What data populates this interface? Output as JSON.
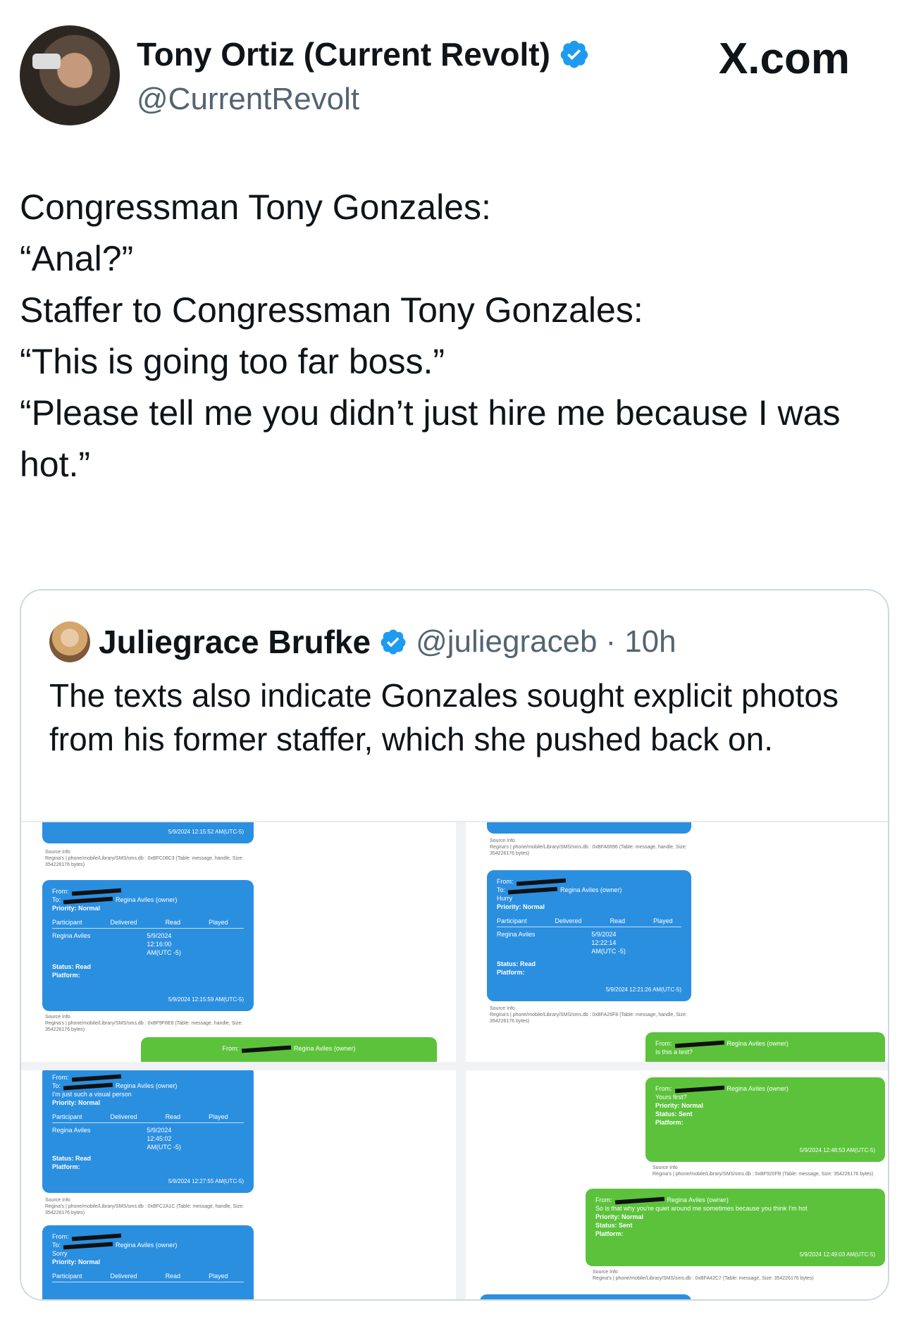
{
  "author": {
    "name": "Tony Ortiz (Current Revolt)",
    "handle": "@CurrentRevolt",
    "verified": true
  },
  "site": "X.com",
  "tweet": {
    "lines": [
      "Congressman Tony Gonzales:",
      "“Anal?”",
      "",
      "Staffer to Congressman Tony Gonzales:",
      "“This is going too far boss.”",
      "“Please tell me you didn’t just hire me because I was hot.”"
    ]
  },
  "quote": {
    "name": "Juliegrace Brufke",
    "handle": "@juliegraceb",
    "separator": "·",
    "time": "10h",
    "text": "The texts also indicate Gonzales sought explicit photos from his former staffer, which she pushed back on."
  },
  "media": {
    "panel1": {
      "bubble_top": {
        "ts": "5/9/2024 12:15:52 AM(UTC-5)"
      },
      "source1": "Source Info\nRegina's | phone/mobile/Library/SMS/sms.db : 0xBFC08C3 (Table: message, handle, Size: 354226176 bytes)",
      "bubble2": {
        "from": "From:",
        "to": "To:",
        "owner": "Regina Aviles (owner)",
        "priority": "Priority: Normal",
        "col_participant": "Participant",
        "col_delivered": "Delivered",
        "col_read": "Read",
        "col_played": "Played",
        "participant": "Regina Aviles",
        "read": "5/9/2024 12:16:00 AM(UTC -5)",
        "status": "Status: Read",
        "platform": "Platform:",
        "ts": "5/9/2024 12:15:59 AM(UTC-5)"
      },
      "source2": "Source Info\nRegina's | phone/mobile/Library/SMS/sms.db : 0xBF9F8E6 (Table: message, handle, Size: 354226176 bytes)",
      "green": {
        "from": "From:",
        "owner": "Regina Aviles (owner)"
      }
    },
    "panel2": {
      "source1": "Source Info\nRegina's | phone/mobile/Library/SMS/sms.db : 0xBFA6696 (Table: message, handle, Size: 354226176 bytes)",
      "bubble": {
        "from": "From:",
        "to": "To:",
        "owner": "Regina Aviles (owner)",
        "body": "Hurry",
        "priority": "Priority: Normal",
        "col_participant": "Participant",
        "col_delivered": "Delivered",
        "col_read": "Read",
        "col_played": "Played",
        "participant": "Regina Aviles",
        "read": "5/9/2024 12:22:14 AM(UTC -5)",
        "status": "Status: Read",
        "platform": "Platform:",
        "ts": "5/9/2024 12:21:26 AM(UTC-5)"
      },
      "source2": "Source Info\nRegina's | phone/mobile/Library/SMS/sms.db : 0xBFA26F8 (Table: message, handle, Size: 354226176 bytes)",
      "green": {
        "from": "From:",
        "owner": "Regina Aviles (owner)",
        "body": "Is this a test?"
      }
    },
    "panel3": {
      "bubble": {
        "from": "From:",
        "to": "To:",
        "owner": "Regina Aviles (owner)",
        "body": "I'm just such a visual person",
        "priority": "Priority: Normal",
        "col_participant": "Participant",
        "col_delivered": "Delivered",
        "col_read": "Read",
        "col_played": "Played",
        "participant": "Regina Aviles",
        "read": "5/9/2024 12:45:02 AM(UTC -5)",
        "status": "Status: Read",
        "platform": "Platform:",
        "ts": "5/9/2024 12:27:55 AM(UTC-5)"
      },
      "source": "Source Info\nRegina's | phone/mobile/Library/SMS/sms.db : 0xBFC2A1C (Table: message, handle, Size: 354226176 bytes)",
      "bubble2": {
        "from": "From:",
        "to": "To:",
        "owner": "Regina Aviles (owner)",
        "body": "Sorry",
        "priority": "Priority: Normal",
        "col_participant": "Participant",
        "col_delivered": "Delivered",
        "col_read": "Read",
        "col_played": "Played"
      }
    },
    "panel4": {
      "green1": {
        "from": "From:",
        "owner": "Regina Aviles (owner)",
        "body": "Yours first?",
        "priority": "Priority: Normal",
        "status": "Status: Sent",
        "platform": "Platform:",
        "ts": "5/9/2024 12:48:53 AM(UTC-5)"
      },
      "source1": "Source Info\nRegina's | phone/mobile/Library/SMS/sms.db : 0xBF920FB (Table: message, Size: 354226176 bytes)",
      "green2": {
        "from": "From:",
        "owner": "Regina Aviles (owner)",
        "body": "So is that why you're quiet around me sometimes because you think I'm hot",
        "priority": "Priority: Normal",
        "status": "Status: Sent",
        "platform": "Platform:",
        "ts": "5/9/2024 12:49:03 AM(UTC-5)"
      },
      "source2": "Source Info\nRegina's | phone/mobile/Library/SMS/sms.db : 0xBFA42C7 (Table: message, Size: 354226176 bytes)"
    }
  },
  "colors": {
    "blue_bubble": "#2b8fe0",
    "green_bubble": "#5cc23c",
    "verified": "#1d9bf0",
    "secondary_text": "#536471"
  }
}
